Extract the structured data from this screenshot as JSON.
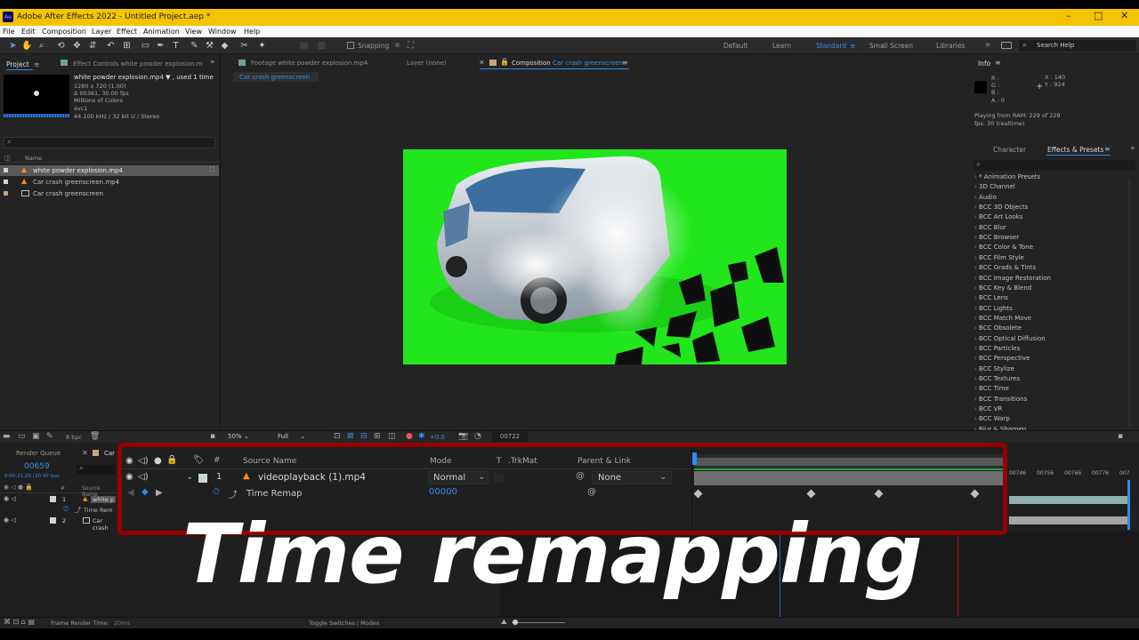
{
  "app": {
    "title": "Adobe After Effects 2022 - Untitled Project.aep *",
    "icon_label": "Ae"
  },
  "menu": [
    "File",
    "Edit",
    "Composition",
    "Layer",
    "Effect",
    "Animation",
    "View",
    "Window",
    "Help"
  ],
  "toolbar": {
    "snapping_label": "Snapping",
    "workspaces": [
      "Default",
      "Learn",
      "Standard",
      "Small Screen",
      "Libraries"
    ],
    "active_workspace": "Standard",
    "search_placeholder": "Search Help"
  },
  "project": {
    "tab_project": "Project",
    "tab_effect_controls": "Effect Controls white powder explosion.m",
    "selected_name": "white powder explosion.mp4 ▼ , used 1 time",
    "meta": [
      "1280 x 720 (1.00)",
      "Δ 00361, 30.00 fps",
      "Millions of Colors",
      "avc1",
      "44.100 kHz / 32 bit U / Stereo"
    ],
    "col_name": "Name",
    "items": [
      "white powder explosion.mp4",
      "Car crash greenscreen.mp4",
      "Car crash greenscreen"
    ],
    "bpc": "8 bpc"
  },
  "composition": {
    "tab_footage": "Footage white powder explosion.mp4",
    "tab_layer": "Layer (none)",
    "tab_comp_prefix": "Composition",
    "tab_comp_name": "Car crash greenscreen",
    "breadcrumb": "Car crash greenscreen",
    "zoom": "50%",
    "resolution": "Full",
    "exposure": "+0.0",
    "frame": "00722"
  },
  "info": {
    "tab": "Info",
    "r": "R :",
    "g": "G :",
    "b": "B :",
    "a": "A : 0",
    "x": "X : 140",
    "y": "Y : 924",
    "ram": "Playing from RAM: 229 of 229",
    "fps": "fps: 30 (realtime)"
  },
  "effects": {
    "tab_character": "Character",
    "tab_effects": "Effects & Presets",
    "items": [
      "* Animation Presets",
      "3D Channel",
      "Audio",
      "BCC 3D Objects",
      "BCC Art Looks",
      "BCC Blur",
      "BCC Browser",
      "BCC Color & Tone",
      "BCC Film Style",
      "BCC Grads & Tints",
      "BCC Image Restoration",
      "BCC Key & Blend",
      "BCC Lens",
      "BCC Lights",
      "BCC Match Move",
      "BCC Obsolete",
      "BCC Optical Diffusion",
      "BCC Particles",
      "BCC Perspective",
      "BCC Stylize",
      "BCC Textures",
      "BCC Time",
      "BCC Transitions",
      "BCC VR",
      "BCC Warp",
      "Blur & Sharpen"
    ]
  },
  "timeline": {
    "tab_render": "Render Queue",
    "tab_comp": "Car",
    "timecode": "00659",
    "timecode_sub": "0:00:21:29 (30.00 fps)",
    "col_source": "Source Name",
    "layer1": "white p",
    "time_remap_short": "Time Rem",
    "layer2": "Car crash",
    "ruler": [
      "00746",
      "00756",
      "00766",
      "00776",
      "007"
    ],
    "frame_render_time_label": "Frame Render Time:",
    "frame_render_time": "20ms",
    "toggle_label": "Toggle Switches / Modes"
  },
  "overlay": {
    "col_num": "#",
    "col_source": "Source Name",
    "col_mode": "Mode",
    "col_t": "T",
    "col_trkmat": ".TrkMat",
    "col_parent": "Parent & Link",
    "layer_num": "1",
    "layer_name": "videoplayback (1).mp4",
    "mode": "Normal",
    "parent": "None",
    "prop_name": "Time Remap",
    "prop_value": "00000"
  },
  "caption": "Time remapping",
  "colors": {
    "title_bar": "#f5c400",
    "green_screen": "#22e61c",
    "highlight_box": "#950000",
    "accent_blue": "#2d8ceb"
  }
}
